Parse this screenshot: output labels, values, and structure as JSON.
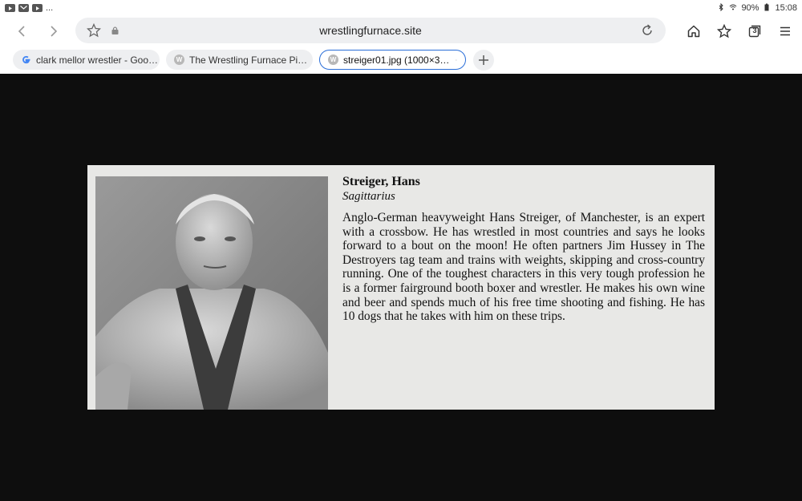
{
  "status_bar": {
    "notification_icons": [
      "youtube-icon",
      "mail-icon",
      "youtube-icon"
    ],
    "overflow": "...",
    "bluetooth": "bluetooth-icon",
    "wifi": "wifi-icon",
    "battery_percent": "90%",
    "battery_icon": "battery-icon",
    "time": "15:08"
  },
  "toolbar": {
    "url": "wrestlingfurnace.site",
    "tab_count": "3"
  },
  "tabs": [
    {
      "favicon": "google-icon",
      "title": "clark mellor wrestler - Goo…",
      "active": false
    },
    {
      "favicon": "W",
      "title": "The Wrestling Furnace Pi…",
      "active": false
    },
    {
      "favicon": "W",
      "title": "streiger01.jpg (1000×3…",
      "active": true
    }
  ],
  "image": {
    "name": "Streiger, Hans",
    "sign": "Sagittarius",
    "bio": "Anglo-German heavyweight Hans Streiger, of Manchester, is an expert with a crossbow. He has wrestled in most countries and says he looks forward to a bout on the moon! He often partners Jim Hussey in The Destroyers tag team and trains with weights, skipping and cross-country running. One of the toughest characters in this very tough profession he is a former fairground booth boxer and wrestler. He makes his own wine and beer and spends much of his free time shooting and fishing. He has 10 dogs that he takes with him on these trips."
  },
  "colors": {
    "active_tab_border": "#2a6ed8",
    "viewer_background": "#0e0e0e",
    "scan_paper": "#e8e8e6"
  }
}
